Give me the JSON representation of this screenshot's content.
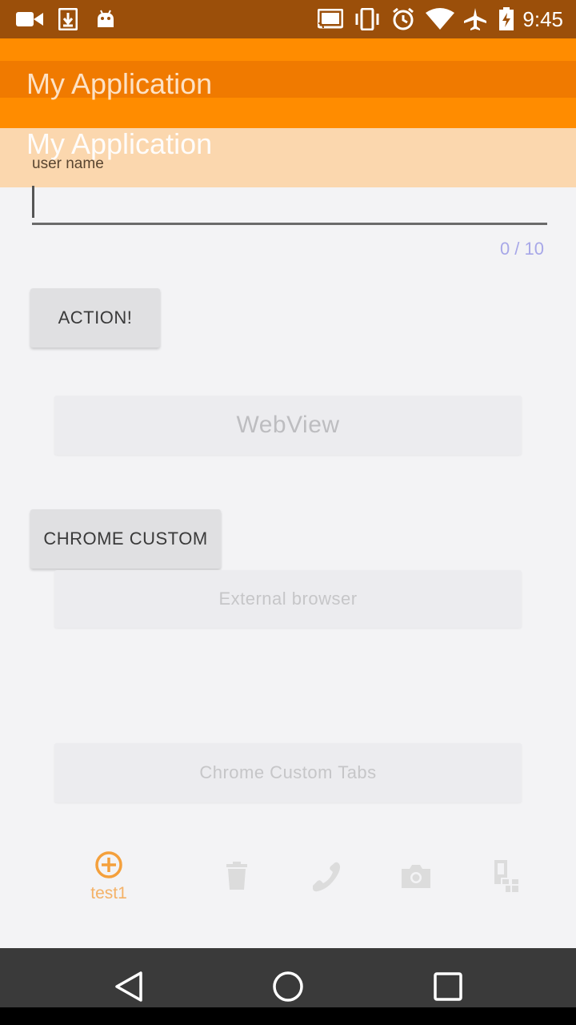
{
  "status_bar": {
    "time": "9:45",
    "icons": [
      "video-camera-icon",
      "download-icon",
      "android-icon",
      "cast-icon",
      "vibrate-icon",
      "alarm-icon",
      "wifi-icon",
      "airplane-icon",
      "battery-charging-icon"
    ]
  },
  "toolbar": {
    "title": "My Application",
    "title_overlay": "My Application"
  },
  "form": {
    "username_label": "user name",
    "username_value": "",
    "char_counter": "0 / 10"
  },
  "buttons": {
    "action": "ACTION!",
    "webview": "WebView",
    "chrome_custom": "CHROME CUSTOM",
    "external_browser": "External browser",
    "chrome_custom_tabs": "Chrome Custom Tabs"
  },
  "bottom_nav": {
    "items": [
      {
        "icon": "add-circle-icon",
        "label": "test1"
      },
      {
        "icon": "trash-icon",
        "label": ""
      },
      {
        "icon": "phone-icon",
        "label": ""
      },
      {
        "icon": "camera-icon",
        "label": ""
      },
      {
        "icon": "devices-icon",
        "label": ""
      }
    ],
    "accent_color": "#f4a03c"
  },
  "colors": {
    "status_bar": "#9b4f0a",
    "toolbar": "#ff8c00",
    "toolbar_overlay": "#fbd7ae",
    "background": "#f3f3f5"
  }
}
